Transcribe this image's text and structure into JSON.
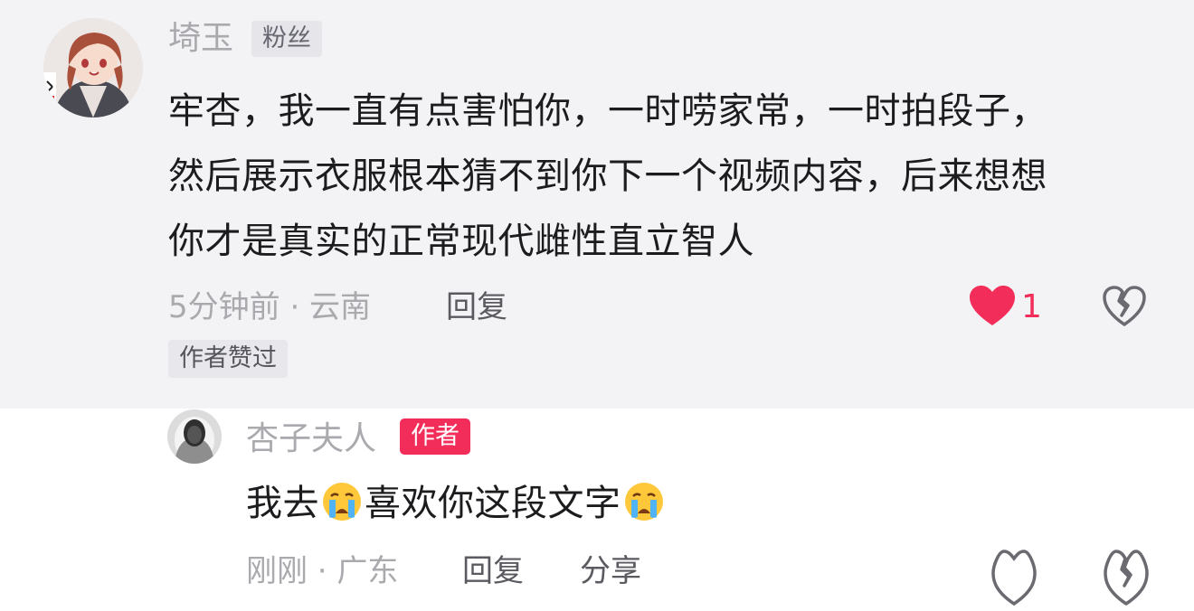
{
  "comment": {
    "username": "埼玉",
    "badge": "粉丝",
    "lines": [
      "牢杏，我一直有点害怕你，一时唠家常，一时拍段子，",
      "然后展示衣服根本猜不到你下一个视频内容，后来想想",
      "你才是真实的正常现代雌性直立智人"
    ],
    "meta": "5分钟前 · 云南",
    "reply_label": "回复",
    "author_liked_tag": "作者赞过",
    "like_count": "1"
  },
  "reply": {
    "username": "杏子夫人",
    "badge": "作者",
    "text_before": "我去",
    "text_after": "喜欢你这段文字",
    "meta": "刚刚 · 广东",
    "reply_label": "回复",
    "share_label": "分享"
  },
  "colors": {
    "accent": "#f22d5a",
    "top_background": "#f3f3f5"
  },
  "icons": {
    "like": "heart-icon",
    "dislike": "broken-heart-icon",
    "emoji": "crying-face-emoji"
  }
}
